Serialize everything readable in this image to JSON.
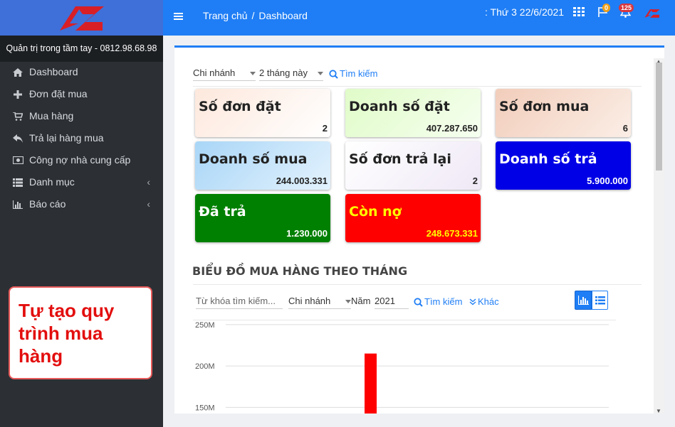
{
  "sidebar": {
    "slogan": "Quản trị trong tầm tay - 0812.98.68.98",
    "items": [
      {
        "label": "Dashboard",
        "icon": "home-icon"
      },
      {
        "label": "Đơn đặt mua",
        "icon": "plus-icon"
      },
      {
        "label": "Mua hàng",
        "icon": "cart-icon"
      },
      {
        "label": "Trả lại hàng mua",
        "icon": "reply-icon"
      },
      {
        "label": "Công nợ nhà cung cấp",
        "icon": "money-icon"
      },
      {
        "label": "Danh mục",
        "icon": "list-icon"
      },
      {
        "label": "Báo cáo",
        "icon": "bar-chart-icon"
      }
    ]
  },
  "note": {
    "text": "Tự tạo quy trình mua hàng"
  },
  "topbar": {
    "crumb_home": "Trang chủ",
    "crumb_sep": "/",
    "crumb_current": "Dashboard",
    "date": ": Thứ 3 22/6/2021",
    "flag_badge": "0",
    "bell_badge": "125"
  },
  "filters": {
    "branch": "Chi nhánh",
    "period": "2 tháng này",
    "search": "Tìm kiếm"
  },
  "cards": [
    {
      "title": "Số đơn đặt",
      "value": "2",
      "bg": "#fbf0e9",
      "color": "#222"
    },
    {
      "title": "Doanh số đặt",
      "value": "407.287.650",
      "bg": "#e6fbd3",
      "color": "#222"
    },
    {
      "title": "Số đơn mua",
      "value": "6",
      "bg": "#f3d9cc",
      "color": "#222"
    },
    {
      "title": "Doanh số mua",
      "value": "244.003.331",
      "bg": "#bfe1f9",
      "color": "#222"
    },
    {
      "title": "Số đơn trả lại",
      "value": "2",
      "bg": "#f7f3fa",
      "color": "#222"
    },
    {
      "title": "Doanh số trả",
      "value": "5.900.000",
      "bg": "#0000e6",
      "color": "#ffffff"
    },
    {
      "title": "Đã trả",
      "value": "1.230.000",
      "bg": "#008000",
      "color": "#ffffff"
    },
    {
      "title": "Còn nợ",
      "value": "248.673.331",
      "bg": "#ff0000",
      "color": "#ffff00"
    }
  ],
  "section_title": "BIỂU ĐỒ MUA HÀNG THEO THÁNG",
  "chart_filters": {
    "keyword_placeholder": "Từ khóa tìm kiếm...",
    "branch": "Chi nhánh",
    "year_label": "Năm",
    "year": "2021",
    "search": "Tìm kiếm",
    "more": "Khác"
  },
  "chart_data": {
    "type": "bar",
    "yticks": [
      "250M",
      "200M",
      "150M"
    ],
    "y_values": [
      250000000,
      200000000,
      150000000
    ],
    "ylim": [
      140000000,
      255000000
    ],
    "values": [
      215000000
    ],
    "bar_color": "#ff0000"
  }
}
